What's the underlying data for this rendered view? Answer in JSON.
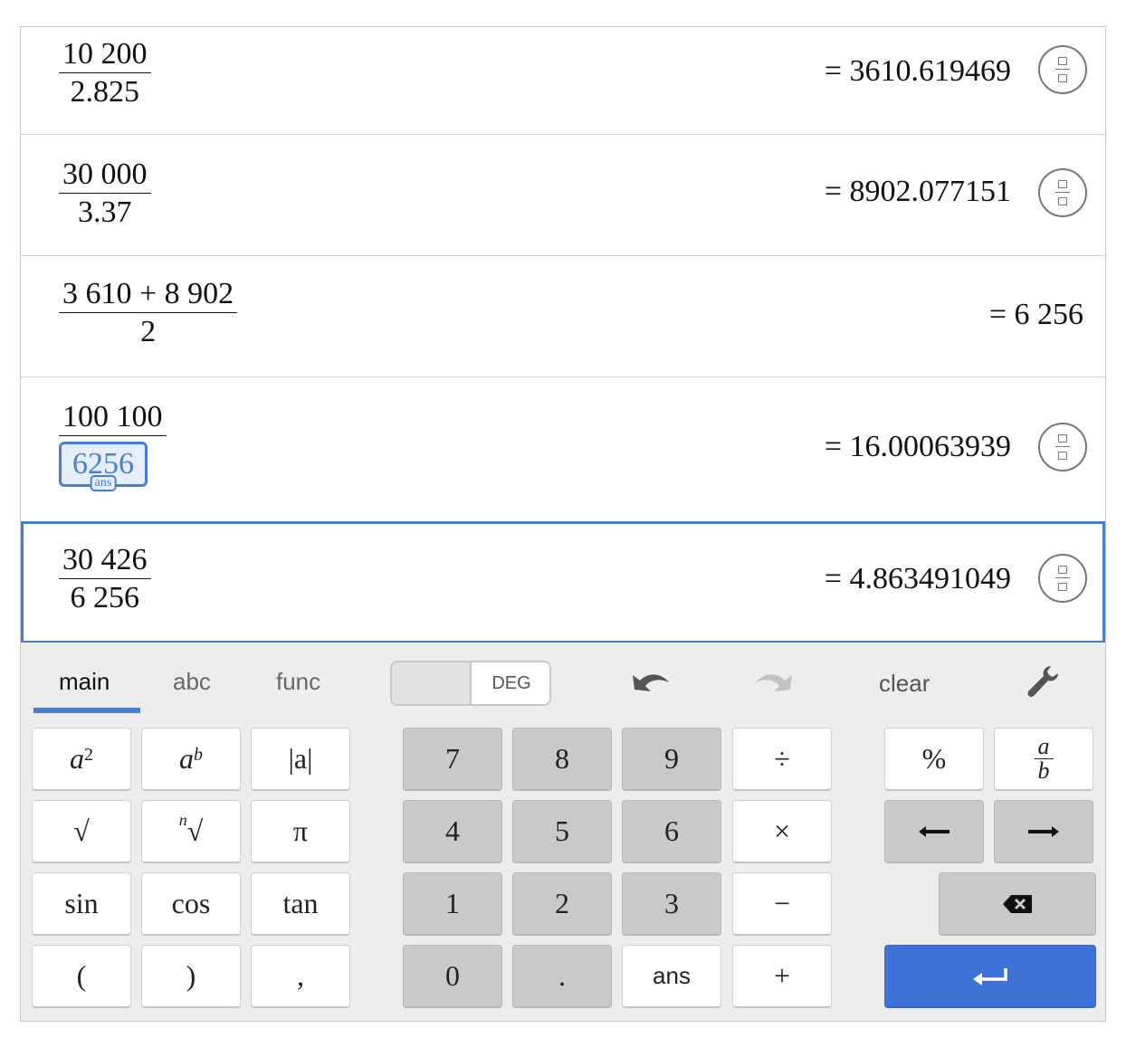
{
  "history": [
    {
      "numerator": "10 200",
      "denominator": "2.825",
      "result": "= 3610.619469",
      "has_toggle": true
    },
    {
      "numerator": "30 000",
      "denominator": "3.37",
      "result": "= 8902.077151",
      "has_toggle": true
    },
    {
      "numerator": "3 610 + 8 902",
      "denominator": "2",
      "result": "= 6 256",
      "has_toggle": false
    },
    {
      "numerator": "100 100",
      "denominator_ans": "6256",
      "ans_tag": "ans",
      "result": "= 16.00063939",
      "has_toggle": true
    },
    {
      "numerator": "30 426",
      "denominator": "6 256",
      "result": "= 4.863491049",
      "has_toggle": true,
      "selected": true
    }
  ],
  "keypad": {
    "tabs": [
      "main",
      "abc",
      "func"
    ],
    "active_tab": "main",
    "angle_mode": "DEG",
    "clear_label": "clear",
    "keys": {
      "a_squared": {
        "base": "a",
        "exp": "2"
      },
      "a_power_b": {
        "base": "a",
        "exp": "b"
      },
      "abs": "|a|",
      "sqrt": "√",
      "nth_root": {
        "index": "n",
        "radical": "√"
      },
      "pi": "π",
      "sin": "sin",
      "cos": "cos",
      "tan": "tan",
      "lparen": "(",
      "rparen": ")",
      "comma": ",",
      "digits": [
        "7",
        "8",
        "9",
        "4",
        "5",
        "6",
        "1",
        "2",
        "3",
        "0",
        "."
      ],
      "ans": "ans",
      "divide": "÷",
      "times": "×",
      "minus": "−",
      "plus": "+",
      "percent": "%",
      "fraction": {
        "top": "a",
        "bottom": "b"
      }
    }
  },
  "colors": {
    "accent": "#4a7fd0",
    "enter": "#3f72d6",
    "gray_key": "#c9c9c9",
    "keypad_bg": "#ededed"
  }
}
